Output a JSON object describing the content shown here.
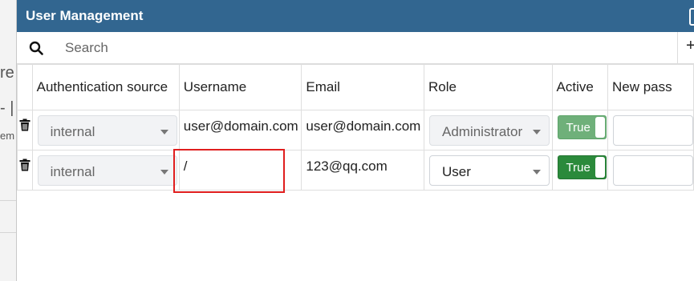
{
  "background": {
    "fragments": [
      "re",
      "- |",
      "em"
    ]
  },
  "dialog": {
    "title": "User Management"
  },
  "search": {
    "placeholder": "Search",
    "add_glyph": "+"
  },
  "table": {
    "columns": [
      "Authentication source",
      "Username",
      "Email",
      "Role",
      "Active",
      "New pass"
    ],
    "rows": [
      {
        "auth_source": "internal",
        "username": "user@domain.com",
        "email": "user@domain.com",
        "role": "Administrator",
        "active": "True",
        "new_password": ""
      },
      {
        "auth_source": "internal",
        "username": "/",
        "email": "123@qq.com",
        "role": "User",
        "active": "True",
        "new_password": ""
      }
    ]
  },
  "colors": {
    "titlebar": "#326690",
    "toggle_disabled": "#6fb07a",
    "toggle_enabled": "#2b8a3b",
    "highlight": "#e01e1e"
  },
  "icons": {
    "search": "search-icon",
    "delete": "trash-icon",
    "dropdown": "caret-down-icon"
  }
}
